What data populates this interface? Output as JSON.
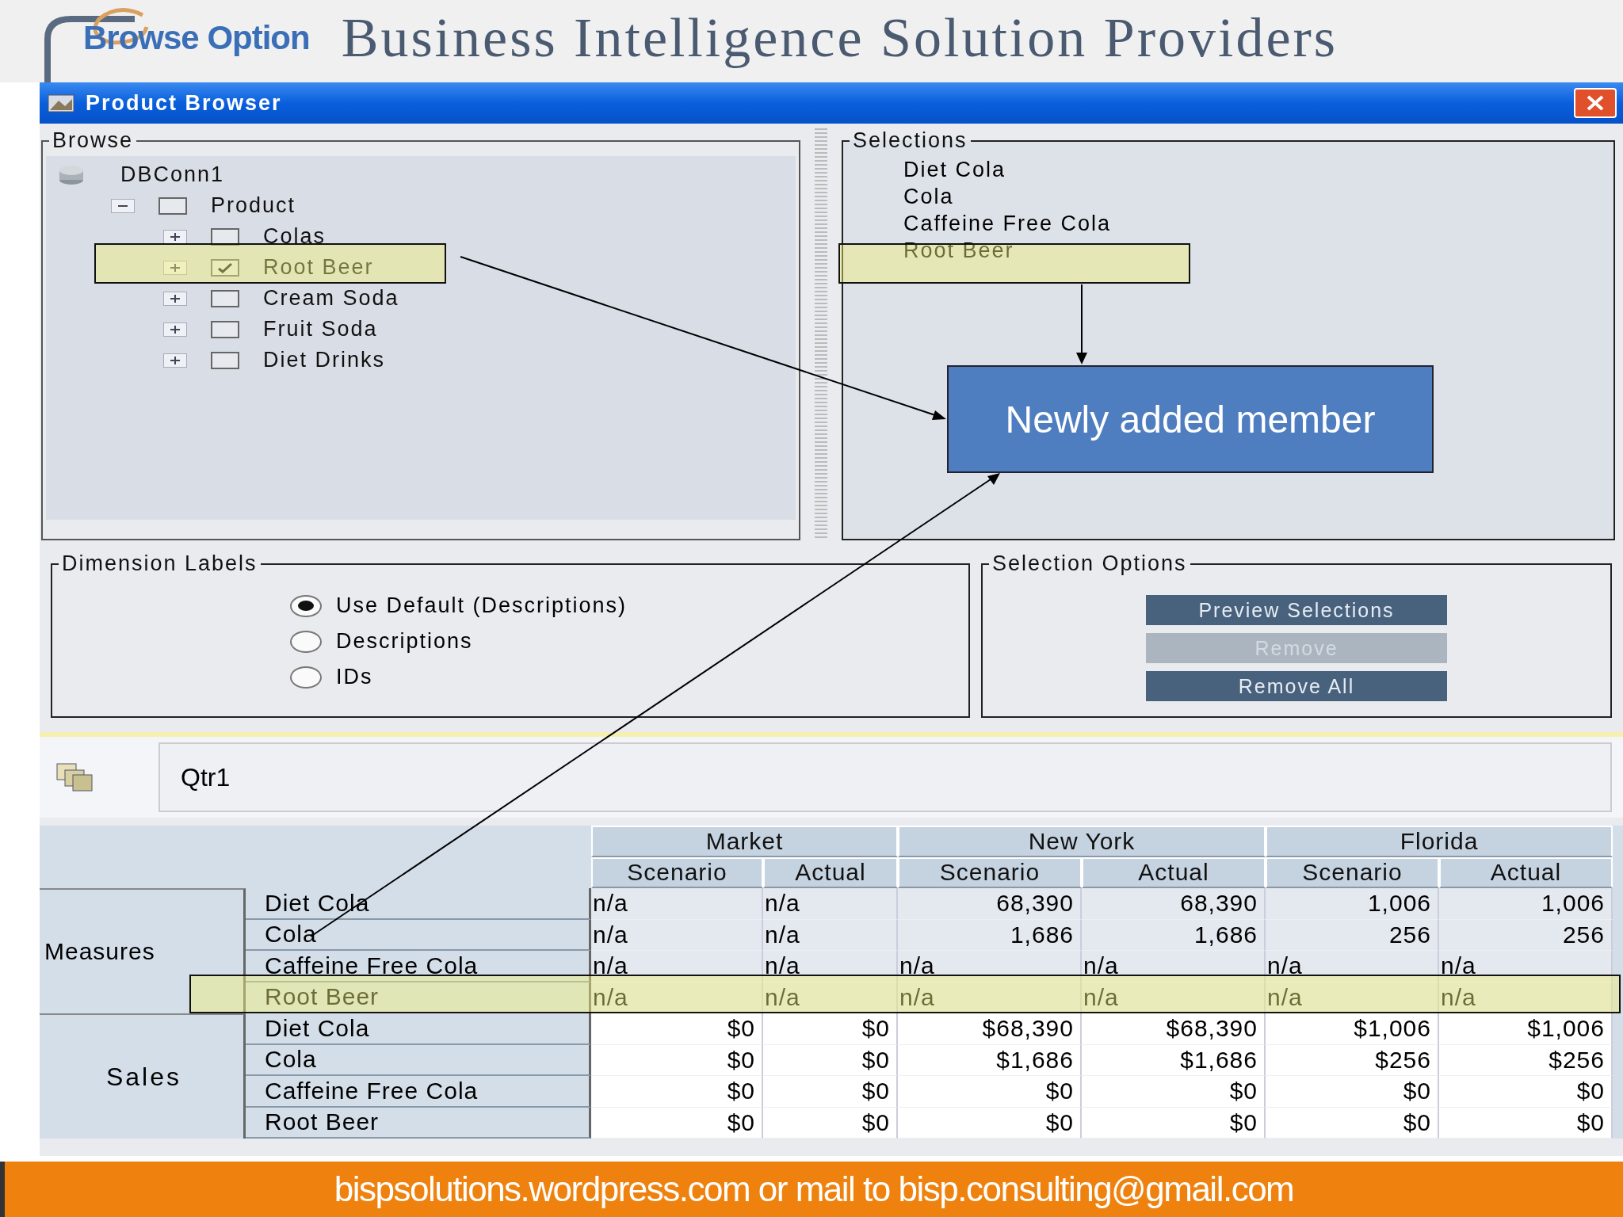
{
  "slide": {
    "logo_text": "Browse Option",
    "title": "Business Intelligence Solution Providers",
    "footer": "bispsolutions.wordpress.com or mail to bisp.consulting@gmail.com"
  },
  "window": {
    "title": "Product Browser"
  },
  "browse": {
    "title": "Browse",
    "tree": [
      {
        "label": "DBConn1",
        "kind": "connection",
        "children": [
          {
            "label": "Product",
            "kind": "member",
            "expanded": true,
            "checked": false,
            "children": [
              {
                "label": "Colas",
                "kind": "member",
                "expanded": false,
                "checked": false
              },
              {
                "label": "Root Beer",
                "kind": "member",
                "expanded": false,
                "checked": true
              },
              {
                "label": "Cream Soda",
                "kind": "member",
                "expanded": false,
                "checked": false
              },
              {
                "label": "Fruit Soda",
                "kind": "member",
                "expanded": false,
                "checked": false
              },
              {
                "label": "Diet Drinks",
                "kind": "member",
                "expanded": false,
                "checked": false
              }
            ]
          }
        ]
      }
    ]
  },
  "selections": {
    "title": "Selections",
    "items": [
      "Diet Cola",
      "Cola",
      "Caffeine Free Cola",
      "Root Beer"
    ]
  },
  "dimension_labels": {
    "title": "Dimension Labels",
    "options": [
      {
        "label": "Use Default (Descriptions)",
        "selected": true
      },
      {
        "label": "Descriptions",
        "selected": false
      },
      {
        "label": "IDs",
        "selected": false
      }
    ]
  },
  "selection_options": {
    "title": "Selection Options",
    "buttons": [
      {
        "label": "Preview Selections",
        "disabled": false
      },
      {
        "label": "Remove",
        "disabled": true
      },
      {
        "label": "Remove All",
        "disabled": false
      }
    ]
  },
  "pov": {
    "value": "Qtr1"
  },
  "table": {
    "column_groups": [
      {
        "label": "Market",
        "columns": [
          "Scenario",
          "Actual"
        ]
      },
      {
        "label": "New York",
        "columns": [
          "Scenario",
          "Actual"
        ]
      },
      {
        "label": "Florida",
        "columns": [
          "Scenario",
          "Actual"
        ]
      }
    ],
    "row_groups": [
      {
        "label": "Measures",
        "kind": "shaded",
        "rows": [
          {
            "label": "Diet Cola",
            "cells": [
              {
                "text": "n/a",
                "kind": "missing"
              },
              {
                "text": "n/a",
                "kind": "missing"
              },
              {
                "text": "68,390",
                "kind": "value"
              },
              {
                "text": "68,390",
                "kind": "value"
              },
              {
                "text": "1,006",
                "kind": "value"
              },
              {
                "text": "1,006",
                "kind": "value"
              }
            ]
          },
          {
            "label": "Cola",
            "cells": [
              {
                "text": "n/a",
                "kind": "missing"
              },
              {
                "text": "n/a",
                "kind": "missing"
              },
              {
                "text": "1,686",
                "kind": "value"
              },
              {
                "text": "1,686",
                "kind": "value"
              },
              {
                "text": "256",
                "kind": "value"
              },
              {
                "text": "256",
                "kind": "value"
              }
            ]
          },
          {
            "label": "Caffeine Free Cola",
            "cells": [
              {
                "text": "n/a",
                "kind": "missing"
              },
              {
                "text": "n/a",
                "kind": "missing"
              },
              {
                "text": "n/a",
                "kind": "missing"
              },
              {
                "text": "n/a",
                "kind": "missing"
              },
              {
                "text": "n/a",
                "kind": "missing"
              },
              {
                "text": "n/a",
                "kind": "missing"
              }
            ]
          },
          {
            "label": "Root Beer",
            "cells": [
              {
                "text": "n/a",
                "kind": "missing"
              },
              {
                "text": "n/a",
                "kind": "missing"
              },
              {
                "text": "n/a",
                "kind": "missing"
              },
              {
                "text": "n/a",
                "kind": "missing"
              },
              {
                "text": "n/a",
                "kind": "missing"
              },
              {
                "text": "n/a",
                "kind": "missing"
              }
            ]
          }
        ]
      },
      {
        "label": "Sales",
        "kind": "plain",
        "rows": [
          {
            "label": "Diet Cola",
            "cells": [
              {
                "text": "$0",
                "kind": "value"
              },
              {
                "text": "$0",
                "kind": "value"
              },
              {
                "text": "$68,390",
                "kind": "value"
              },
              {
                "text": "$68,390",
                "kind": "value"
              },
              {
                "text": "$1,006",
                "kind": "value"
              },
              {
                "text": "$1,006",
                "kind": "value"
              }
            ]
          },
          {
            "label": "Cola",
            "cells": [
              {
                "text": "$0",
                "kind": "value"
              },
              {
                "text": "$0",
                "kind": "value"
              },
              {
                "text": "$1,686",
                "kind": "value"
              },
              {
                "text": "$1,686",
                "kind": "value"
              },
              {
                "text": "$256",
                "kind": "value"
              },
              {
                "text": "$256",
                "kind": "value"
              }
            ]
          },
          {
            "label": "Caffeine Free Cola",
            "cells": [
              {
                "text": "$0",
                "kind": "value"
              },
              {
                "text": "$0",
                "kind": "value"
              },
              {
                "text": "$0",
                "kind": "value"
              },
              {
                "text": "$0",
                "kind": "value"
              },
              {
                "text": "$0",
                "kind": "value"
              },
              {
                "text": "$0",
                "kind": "value"
              }
            ]
          },
          {
            "label": "Root Beer",
            "cells": [
              {
                "text": "$0",
                "kind": "value"
              },
              {
                "text": "$0",
                "kind": "value"
              },
              {
                "text": "$0",
                "kind": "value"
              },
              {
                "text": "$0",
                "kind": "value"
              },
              {
                "text": "$0",
                "kind": "value"
              },
              {
                "text": "$0",
                "kind": "value"
              }
            ]
          }
        ]
      }
    ]
  },
  "callout": {
    "text": "Newly added member"
  }
}
